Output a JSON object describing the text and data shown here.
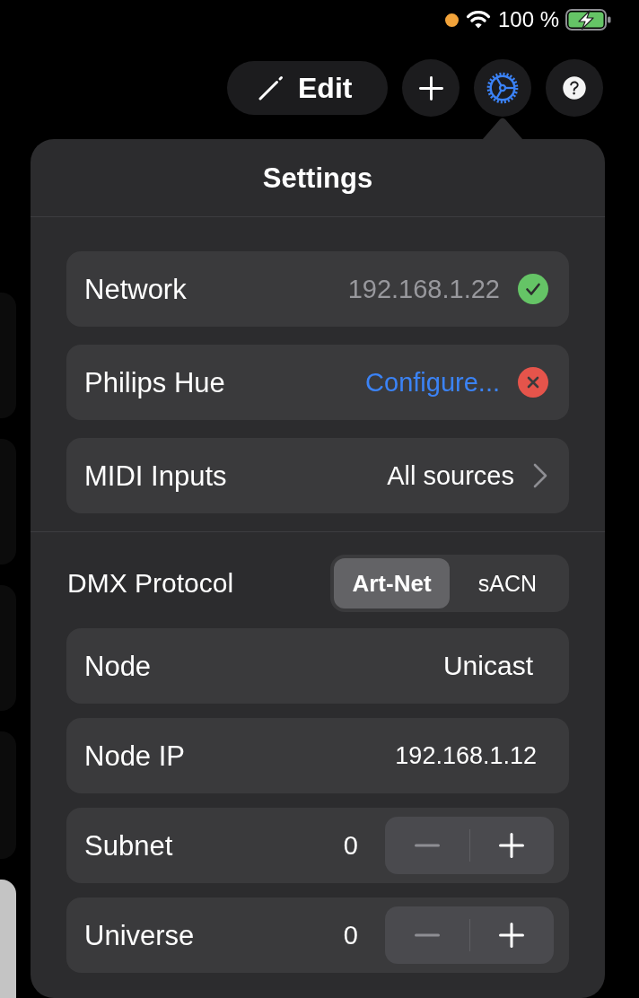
{
  "status_bar": {
    "battery": "100 %"
  },
  "toolbar": {
    "edit_button": "Edit",
    "icon_buttons": [
      {
        "kind": "add",
        "selected": false
      },
      {
        "kind": "settings",
        "selected": true
      },
      {
        "kind": "help",
        "selected": false
      }
    ]
  },
  "popover": {
    "title": "Settings",
    "sections": [
      {
        "rows": [
          {
            "kind": "status",
            "label": "Network",
            "value": "192.168.1.22",
            "connected": true
          },
          {
            "kind": "link",
            "label": "Philips Hue",
            "link": "Configure...",
            "connected": false
          },
          {
            "kind": "disclosure",
            "label": "MIDI Inputs",
            "value": "All sources"
          }
        ]
      },
      {
        "protocol": {
          "label": "DMX Protocol",
          "options": [
            {
              "label": "Art-Net",
              "selected": true
            },
            {
              "label": "sACN",
              "selected": false
            }
          ]
        },
        "rows": [
          {
            "kind": "value",
            "label": "Node",
            "value": "Unicast"
          },
          {
            "kind": "field",
            "label": "Node IP",
            "value": "192.168.1.12"
          },
          {
            "kind": "stepper",
            "label": "Subnet",
            "value": "0",
            "decrement_disabled": true
          },
          {
            "kind": "stepper",
            "label": "Universe",
            "value": "0",
            "decrement_disabled": true
          }
        ]
      }
    ]
  }
}
